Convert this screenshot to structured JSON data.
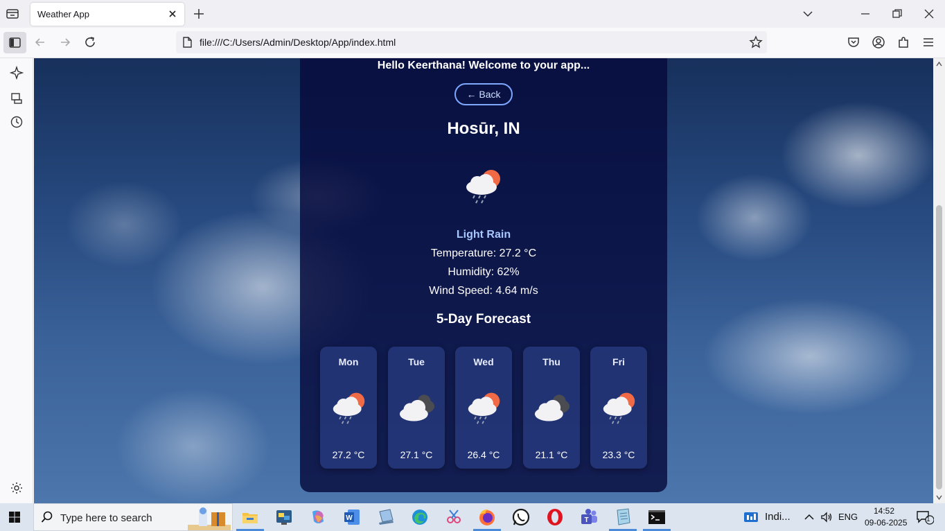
{
  "browser": {
    "tab_title": "Weather App",
    "url": "file:///C:/Users/Admin/Desktop/App/index.html"
  },
  "app": {
    "greeting": "Hello Keerthana! Welcome to your app...",
    "back_label": "← Back",
    "city": "Hosūr, IN",
    "description": "Light Rain",
    "temperature": "Temperature: 27.2 °C",
    "humidity": "Humidity: 62%",
    "wind": "Wind Speed: 4.64 m/s",
    "forecast_title": "5-Day Forecast",
    "forecast": [
      {
        "day": "Mon",
        "temp": "27.2 °C",
        "icon": "light-rain-icon"
      },
      {
        "day": "Tue",
        "temp": "27.1 °C",
        "icon": "cloudy-icon"
      },
      {
        "day": "Wed",
        "temp": "26.4 °C",
        "icon": "light-rain-icon"
      },
      {
        "day": "Thu",
        "temp": "21.1 °C",
        "icon": "cloudy-icon"
      },
      {
        "day": "Fri",
        "temp": "23.3 °C",
        "icon": "light-rain-icon"
      }
    ]
  },
  "taskbar": {
    "search_placeholder": "Type here to search",
    "weather_label": "Indi...",
    "language": "ENG",
    "time": "14:52",
    "date": "09-06-2025",
    "notification_count": "1"
  },
  "colors": {
    "card_bg": "#060a3c",
    "accent": "#7fa8ff",
    "description": "#a9c8ff"
  }
}
